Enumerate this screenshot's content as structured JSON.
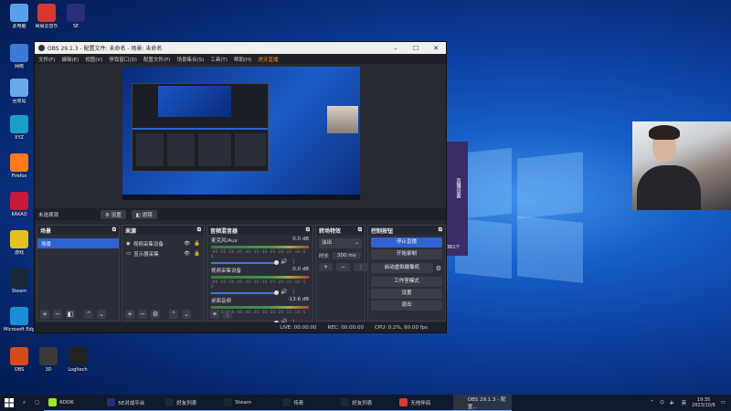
{
  "desktop_icons": [
    {
      "name": "此电脑",
      "color": "#5aa0e6"
    },
    {
      "name": "网易云音乐",
      "color": "#d33a31"
    },
    {
      "name": "SE",
      "color": "#2b2e7a"
    },
    {
      "name": "网络",
      "color": "#3d7ad8"
    },
    {
      "name": "回收站",
      "color": "#6aa8e8"
    },
    {
      "name": "XYZ",
      "color": "#19a0c8"
    },
    {
      "name": "Firefox",
      "color": "#ff7a1a"
    },
    {
      "name": "KAKAO",
      "color": "#c8183c"
    },
    {
      "name": "游戏",
      "color": "#e8c020"
    },
    {
      "name": "Steam",
      "color": "#1b2838"
    },
    {
      "name": "Microsoft Edge",
      "color": "#1a8fd8"
    },
    {
      "name": "OBS",
      "color": "#d84a1a"
    },
    {
      "name": "3D",
      "color": "#3a3a3a"
    },
    {
      "name": "Logitech",
      "color": "#222"
    }
  ],
  "obs": {
    "title": "OBS 29.1.3 - 配置文件: 未命名 - 场景: 未命名",
    "menu": [
      "文件(F)",
      "编辑(E)",
      "视图(V)",
      "停靠窗口(D)",
      "配置文件(P)",
      "场景集合(S)",
      "工具(T)",
      "帮助(H)",
      "虎牙直播"
    ],
    "context": {
      "label": "未选择源",
      "props": "⚙ 设置",
      "filters": "◧ 滤镜"
    },
    "scenes": {
      "title": "场景",
      "items": [
        "场景"
      ]
    },
    "sources": {
      "title": "来源",
      "items": [
        "视频采集设备",
        "显示器采集"
      ]
    },
    "mixer": {
      "title": "音频混音器",
      "channels": [
        {
          "name": "麦克风/Aux",
          "db": "0.0 dB"
        },
        {
          "name": "视频采集设备",
          "db": "0.0 dB"
        },
        {
          "name": "桌面音频",
          "db": "-13.6 dB"
        }
      ],
      "scale": "-60 -55 -50 -45 -40 -35 -30 -25 -20 -15 -10 -5 0"
    },
    "transitions": {
      "title": "转场特效",
      "type": "淡出",
      "duration_label": "时长",
      "duration": "300 ms"
    },
    "controls": {
      "title": "控制按钮",
      "buttons": [
        "停止直播",
        "开始录制",
        "启动虚拟摄像机",
        "工作室模式",
        "设置",
        "退出"
      ]
    },
    "status": {
      "live": "LIVE: 00:00:00",
      "rec": "REC: 00:00:00",
      "cpu": "CPU: 0.2%, 60.00 fps"
    }
  },
  "side_panel": {
    "label": "直播设置",
    "count": "361个"
  },
  "taskbar": {
    "apps": [
      {
        "label": "KOOK",
        "color": "#9be62c"
      },
      {
        "label": "5E对战平台",
        "color": "#2b2e7a"
      },
      {
        "label": "好友列表",
        "color": "#1b2838"
      },
      {
        "label": "Steam",
        "color": "#1b2838"
      },
      {
        "label": "传奇",
        "color": "#1b2838"
      },
      {
        "label": "好友列表",
        "color": "#1b2838"
      },
      {
        "label": "无他伴侣",
        "color": "#d83a3a"
      },
      {
        "label": "OBS 29.1.3 - 配置...",
        "color": "#333"
      }
    ],
    "time": "19:35",
    "date": "2023/10/6"
  }
}
